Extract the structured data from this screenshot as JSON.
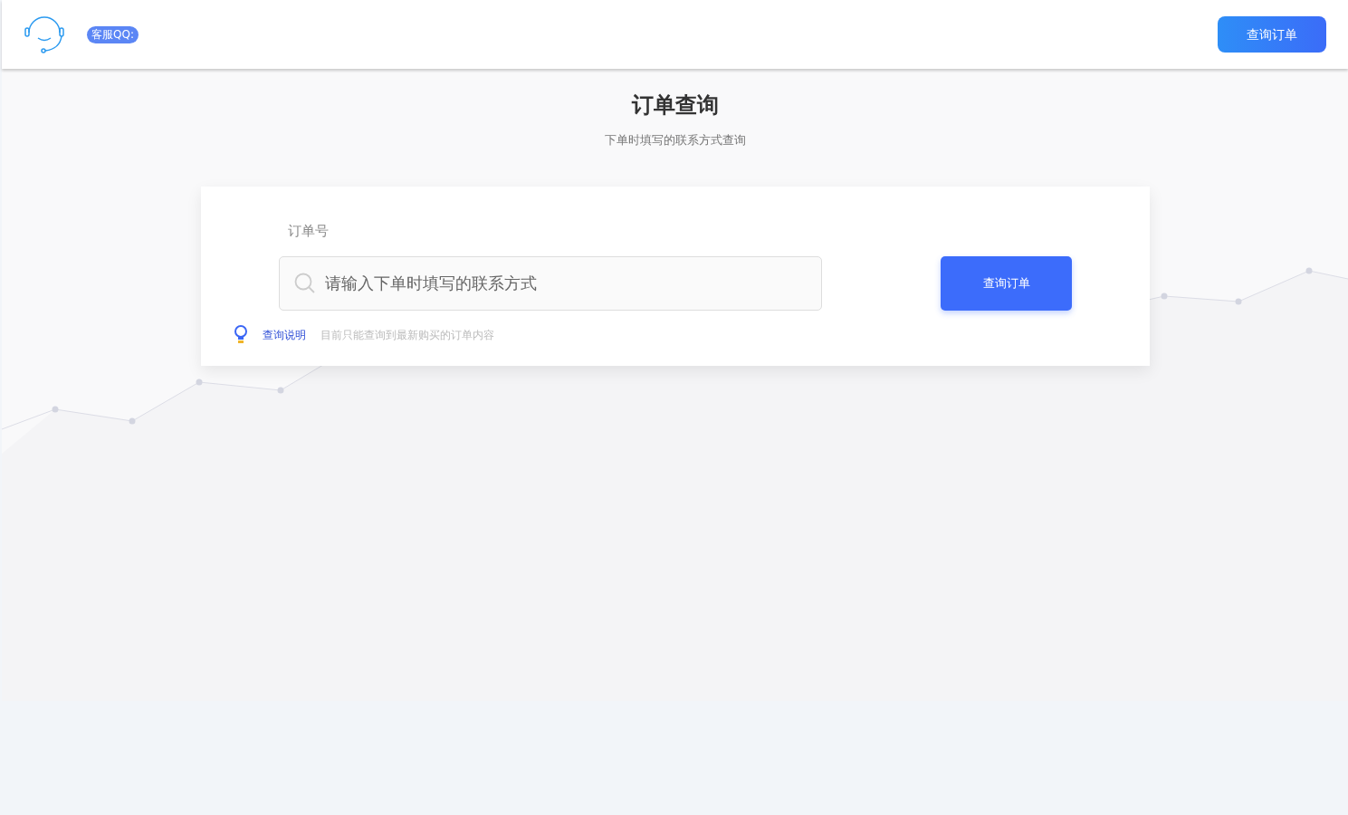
{
  "header": {
    "service_badge": "客服QQ:",
    "query_button": "查询订单"
  },
  "title": "订单查询",
  "subtitle": "下单时填写的联系方式查询",
  "form": {
    "label": "订单号",
    "placeholder": "请输入下单时填写的联系方式",
    "submit": "查询订单"
  },
  "note": {
    "title": "查询说明",
    "text": "目前只能查询到最新购买的订单内容"
  }
}
